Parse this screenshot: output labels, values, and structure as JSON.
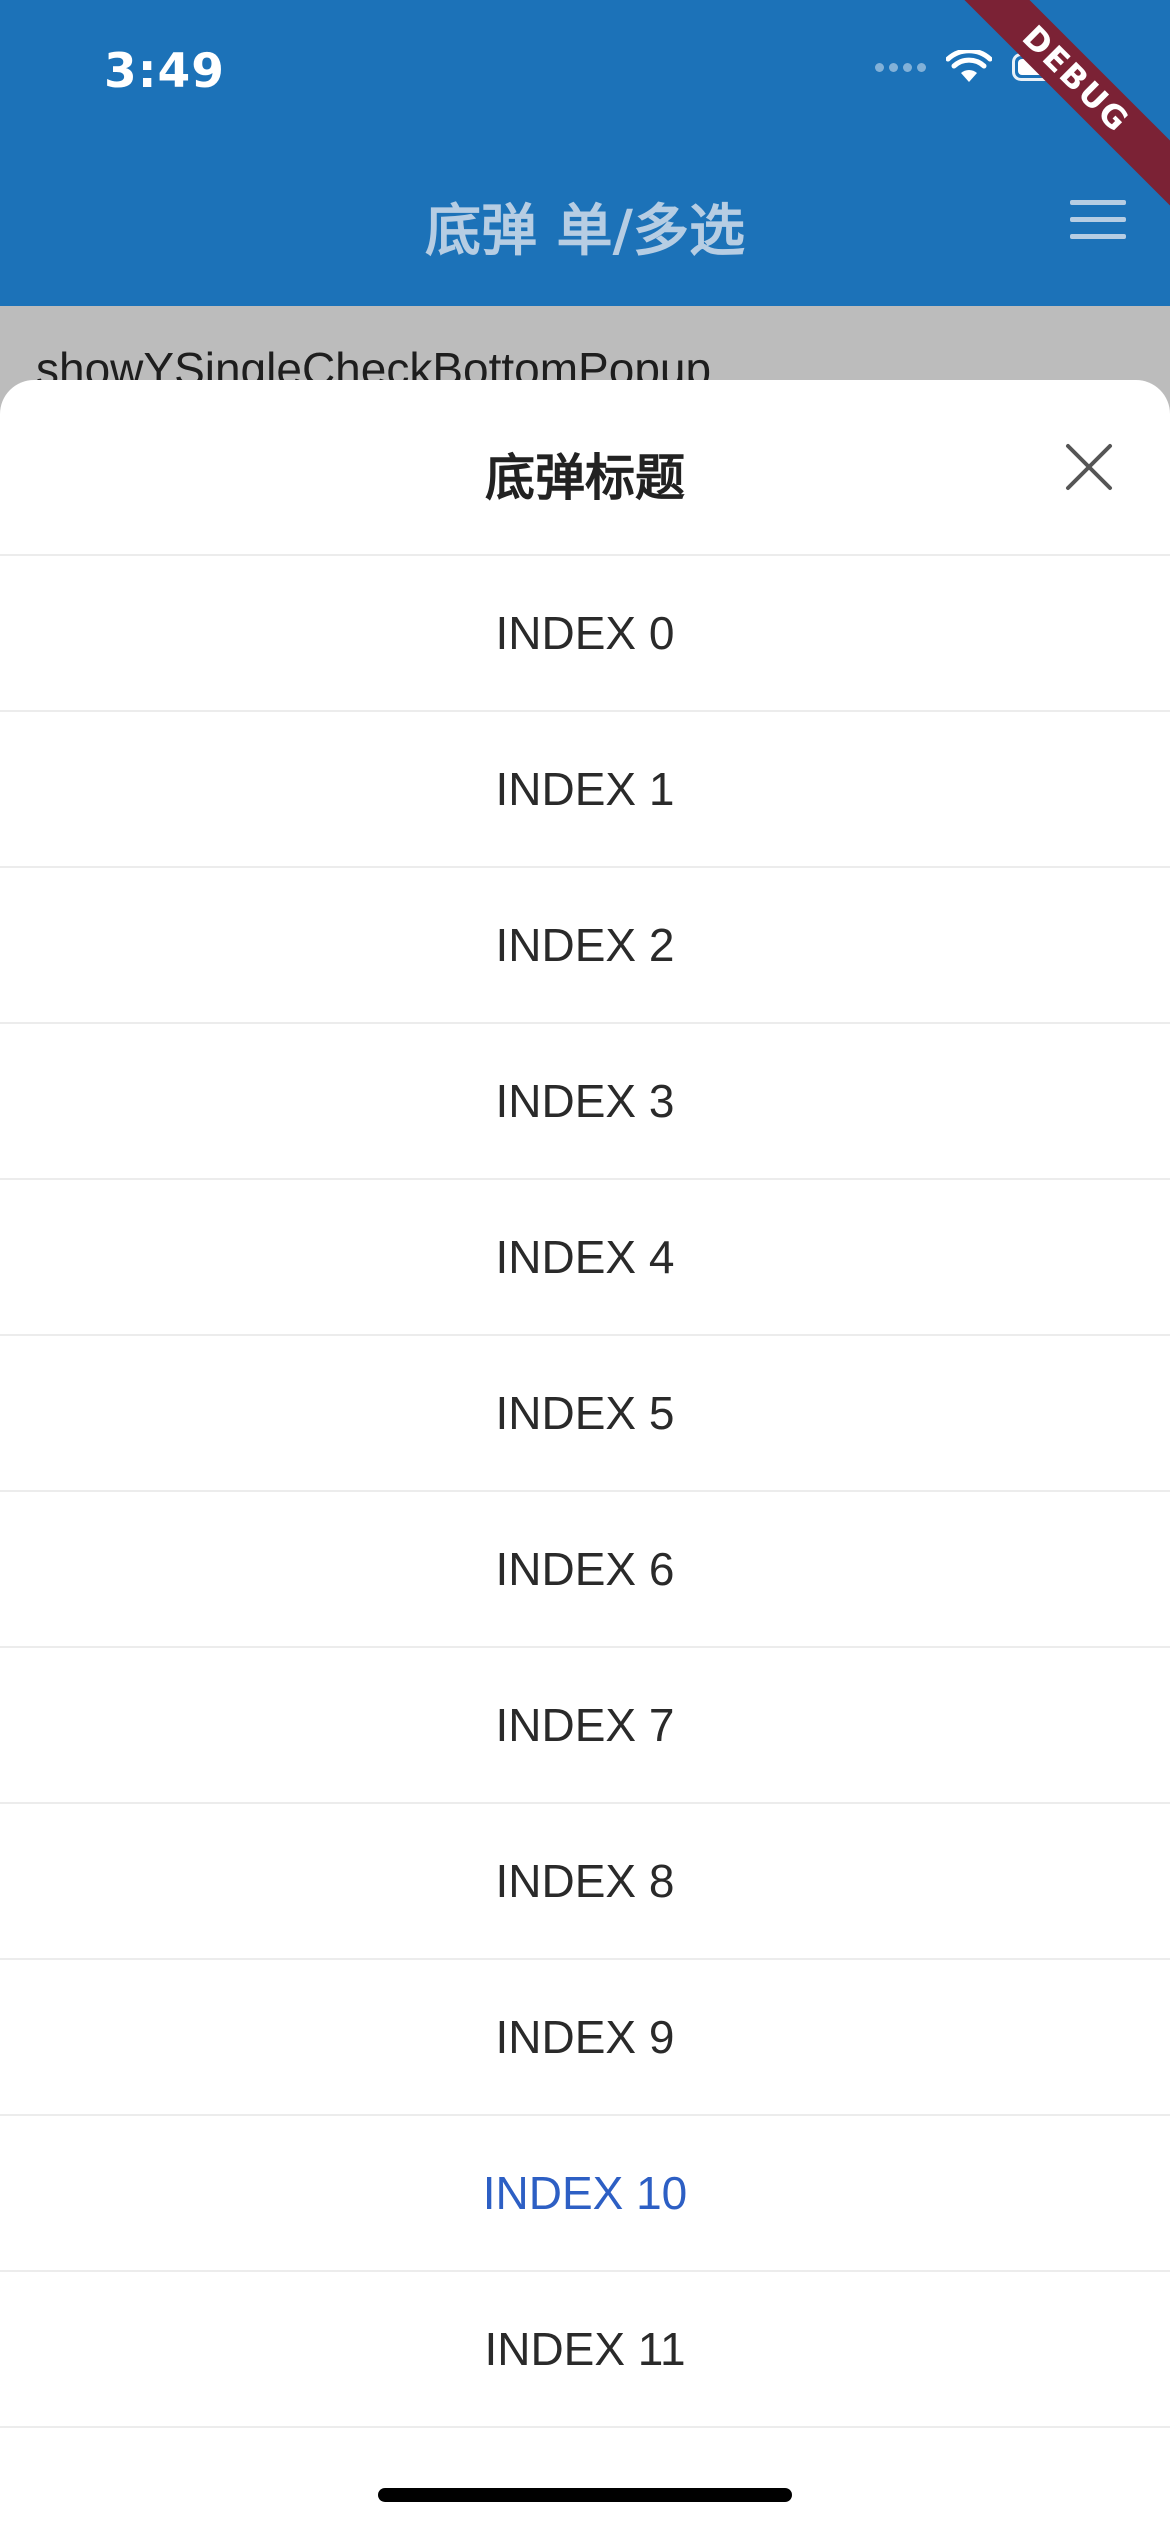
{
  "status_bar": {
    "time": "3:49"
  },
  "app_bar": {
    "title": "底弹 单/多选",
    "background": "#1c72b8",
    "debug_label": "DEBUG"
  },
  "background_content": {
    "first_item": "showYSingleCheckBottomPopup"
  },
  "sheet": {
    "title": "底弹标题",
    "close_icon": "close-icon",
    "selected_index": 10,
    "selected_color": "#2d5fc4",
    "options": [
      {
        "label": "INDEX 0"
      },
      {
        "label": "INDEX 1"
      },
      {
        "label": "INDEX 2"
      },
      {
        "label": "INDEX 3"
      },
      {
        "label": "INDEX 4"
      },
      {
        "label": "INDEX 5"
      },
      {
        "label": "INDEX 6"
      },
      {
        "label": "INDEX 7"
      },
      {
        "label": "INDEX 8"
      },
      {
        "label": "INDEX 9"
      },
      {
        "label": "INDEX 10"
      },
      {
        "label": "INDEX 11"
      }
    ]
  }
}
